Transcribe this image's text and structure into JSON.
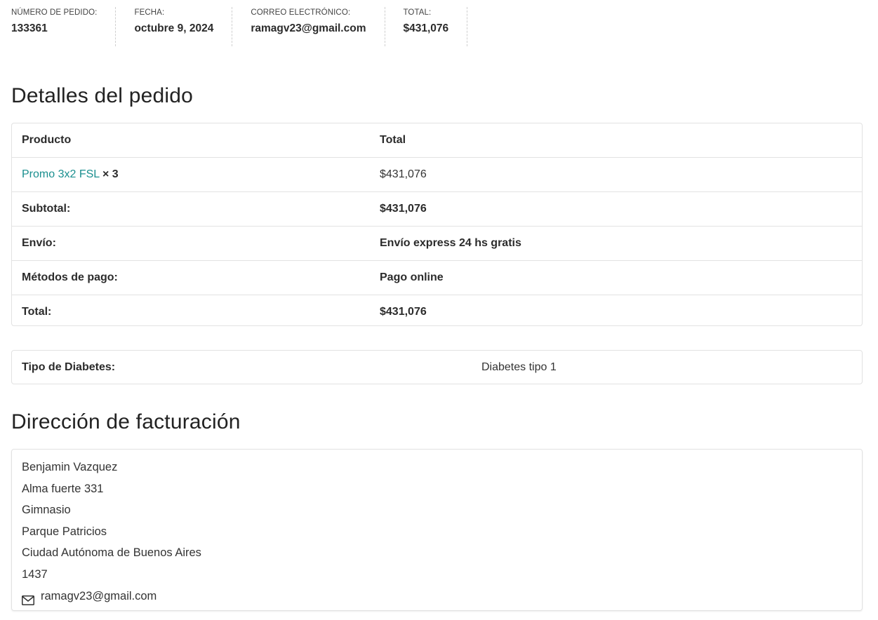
{
  "overview": {
    "order_number_label": "NÚMERO DE PEDIDO:",
    "order_number": "133361",
    "date_label": "FECHA:",
    "date": "octubre 9, 2024",
    "email_label": "CORREO ELECTRÓNICO:",
    "email": "ramagv23@gmail.com",
    "total_label": "TOTAL:",
    "total": "$431,076"
  },
  "details": {
    "title": "Detalles del pedido",
    "header": {
      "product": "Producto",
      "total": "Total"
    },
    "item": {
      "name": "Promo 3x2 FSL",
      "quantity": "× 3",
      "total": "$431,076"
    },
    "rows": [
      {
        "label": "Subtotal:",
        "value": "$431,076"
      },
      {
        "label": "Envío:",
        "value": "Envío express 24 hs gratis"
      },
      {
        "label": "Métodos de pago:",
        "value": "Pago online"
      },
      {
        "label": "Total:",
        "value": "$431,076"
      }
    ]
  },
  "extra": {
    "label": "Tipo de Diabetes:",
    "value": "Diabetes tipo 1"
  },
  "billing": {
    "title": "Dirección de facturación",
    "lines": [
      "Benjamin Vazquez",
      "Alma fuerte 331",
      "Gimnasio",
      "Parque Patricios",
      "Ciudad Autónoma de Buenos Aires",
      "1437"
    ],
    "email": "ramagv23@gmail.com",
    "email_icon": "envelope-icon"
  },
  "colors": {
    "link": "#1a8f8f",
    "border": "#e2e2e2"
  }
}
